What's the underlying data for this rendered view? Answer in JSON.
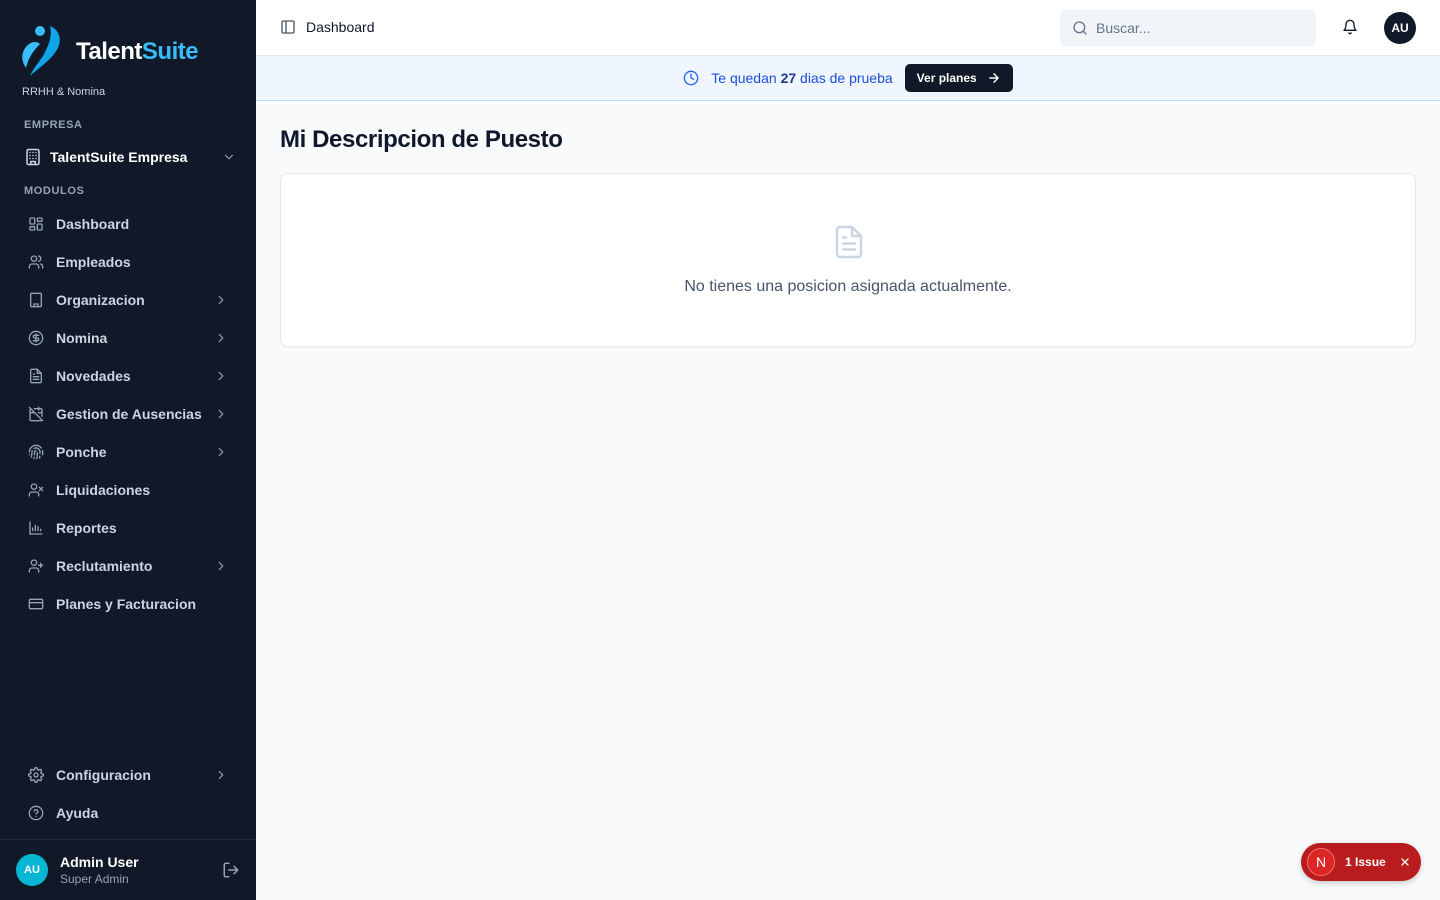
{
  "brand": {
    "name_part1": "Talent",
    "name_part2": "Suite",
    "subtitle": "RRHH & Nomina"
  },
  "sidebar": {
    "company_section_label": "EMPRESA",
    "company_name": "TalentSuite Empresa",
    "modules_section_label": "MODULOS",
    "items": [
      {
        "label": "Dashboard",
        "icon": "grid-icon",
        "expandable": false
      },
      {
        "label": "Empleados",
        "icon": "users-icon",
        "expandable": false
      },
      {
        "label": "Organizacion",
        "icon": "building-icon",
        "expandable": true
      },
      {
        "label": "Nomina",
        "icon": "dollar-circle-icon",
        "expandable": true
      },
      {
        "label": "Novedades",
        "icon": "file-text-icon",
        "expandable": true
      },
      {
        "label": "Gestion de Ausencias",
        "icon": "calendar-off-icon",
        "expandable": true
      },
      {
        "label": "Ponche",
        "icon": "fingerprint-icon",
        "expandable": true
      },
      {
        "label": "Liquidaciones",
        "icon": "user-x-icon",
        "expandable": false
      },
      {
        "label": "Reportes",
        "icon": "bar-chart-icon",
        "expandable": false
      },
      {
        "label": "Reclutamiento",
        "icon": "user-plus-icon",
        "expandable": true
      },
      {
        "label": "Planes y Facturacion",
        "icon": "credit-card-icon",
        "expandable": false
      }
    ],
    "bottom_items": [
      {
        "label": "Configuracion",
        "icon": "settings-icon",
        "expandable": true
      },
      {
        "label": "Ayuda",
        "icon": "help-circle-icon",
        "expandable": false
      }
    ],
    "user": {
      "initials": "AU",
      "name": "Admin User",
      "role": "Super Admin"
    }
  },
  "header": {
    "title": "Dashboard",
    "search_placeholder": "Buscar...",
    "avatar_initials": "AU"
  },
  "trial_banner": {
    "text_before": "Te quedan ",
    "days": "27",
    "text_after": " dias de prueba",
    "button_label": "Ver planes"
  },
  "main": {
    "title": "Mi Descripcion de Puesto",
    "empty_message": "No tienes una posicion asignada actualmente."
  },
  "issue_toast": {
    "badge": "N",
    "label": "1 Issue"
  },
  "colors": {
    "sidebar_bg": "#111827",
    "accent": "#2563eb",
    "issue_bg": "#b91c1c"
  }
}
